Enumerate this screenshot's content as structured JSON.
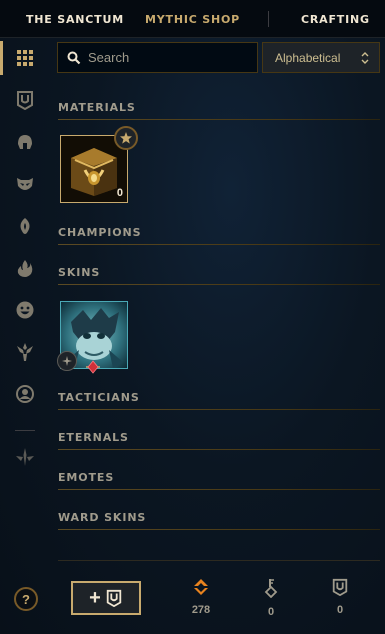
{
  "nav": {
    "tabs": [
      {
        "label": "THE SANCTUM"
      },
      {
        "label": "MYTHIC SHOP"
      },
      {
        "label": "CRAFTING"
      }
    ]
  },
  "sidebar": {
    "items": [
      {
        "icon": "grid-icon",
        "active": true
      },
      {
        "icon": "chest-icon"
      },
      {
        "icon": "helmet-icon"
      },
      {
        "icon": "mask-icon"
      },
      {
        "icon": "ward-icon"
      },
      {
        "icon": "flame-icon"
      },
      {
        "icon": "emote-face-icon"
      },
      {
        "icon": "eternals-icon"
      },
      {
        "icon": "profile-icon"
      },
      {
        "icon": "tft-icon"
      }
    ]
  },
  "search": {
    "placeholder": "Search"
  },
  "sort": {
    "selected": "Alphabetical"
  },
  "sections": {
    "materials": "MATERIALS",
    "champions": "CHAMPIONS",
    "skins": "SKINS",
    "tacticians": "TACTICIANS",
    "eternals": "ETERNALS",
    "emotes": "EMOTES",
    "ward_skins": "WARD SKINS"
  },
  "materials": {
    "items": [
      {
        "name": "chest",
        "count": "0"
      }
    ]
  },
  "skins": {
    "items": [
      {
        "name": "skin-shard"
      }
    ]
  },
  "footer": {
    "help": "?",
    "add_label": "+",
    "currencies": [
      {
        "icon": "orange-essence-icon",
        "value": "278",
        "color": "#e8831f"
      },
      {
        "icon": "key-icon",
        "value": "0"
      },
      {
        "icon": "chest-icon",
        "value": "0"
      }
    ]
  },
  "colors": {
    "gold": "#c8aa6e",
    "gold_dark": "#785a28",
    "background": "#0a1118",
    "text_light": "#f0e6d2",
    "orange_essence": "#e8831f"
  }
}
